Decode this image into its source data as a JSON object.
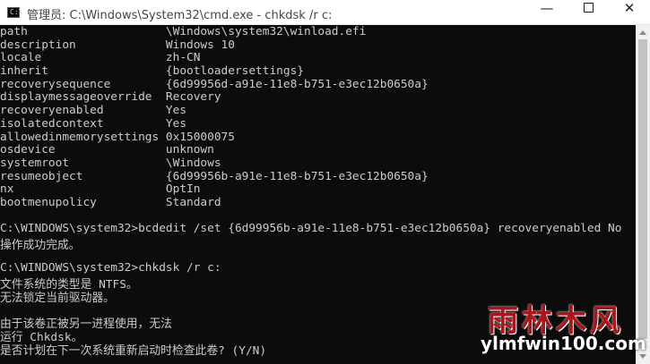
{
  "window": {
    "title": "管理员: C:\\Windows\\System32\\cmd.exe - chkdsk  /r c:",
    "icon_text": "C:\\",
    "minimize_glyph": "—",
    "close_glyph": "✕"
  },
  "console": {
    "lines": [
      "path                    \\Windows\\system32\\winload.efi",
      "description             Windows 10",
      "locale                  zh-CN",
      "inherit                 {bootloadersettings}",
      "recoverysequence        {6d99956d-a91e-11e8-b751-e3ec12b0650a}",
      "displaymessageoverride  Recovery",
      "recoveryenabled         Yes",
      "isolatedcontext         Yes",
      "allowedinmemorysettings 0x15000075",
      "osdevice                unknown",
      "systemroot              \\Windows",
      "resumeobject            {6d99956b-a91e-11e8-b751-e3ec12b0650a}",
      "nx                      OptIn",
      "bootmenupolicy          Standard",
      "",
      "C:\\WINDOWS\\system32>bcdedit /set {6d99956b-a91e-11e8-b751-e3ec12b0650a} recoveryenabled No",
      "操作成功完成。",
      "",
      "C:\\WINDOWS\\system32>chkdsk /r c:",
      "文件系统的类型是 NTFS。",
      "无法锁定当前驱动器。",
      "",
      "由于该卷正被另一进程使用，无法",
      "运行 Chkdsk。",
      "是否计划在下一次系统重新启动时检查此卷? (Y/N)"
    ]
  },
  "watermark": {
    "cn": "雨林木风",
    "en": "ylmfwin100.com"
  }
}
